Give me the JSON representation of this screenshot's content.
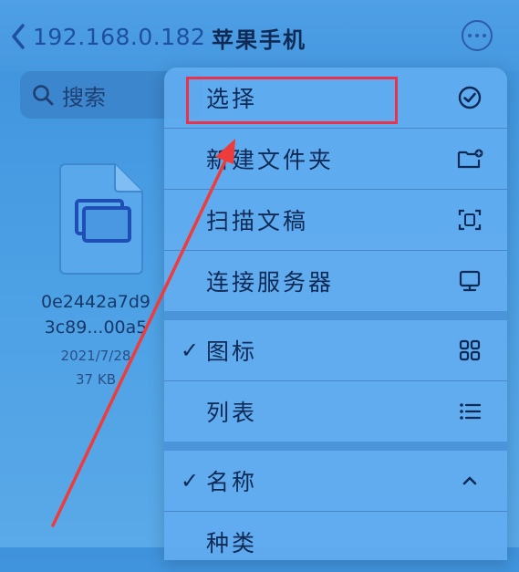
{
  "navbar": {
    "back_label": "192.168.0.182",
    "title": "苹果手机",
    "more_icon": "ellipsis-circle-icon"
  },
  "search": {
    "placeholder": "搜索"
  },
  "file": {
    "name_line1": "0e2442a7d9",
    "name_line2": "3c89...00a5",
    "date": "2021/7/28",
    "size": "37 KB"
  },
  "menu": {
    "items": [
      {
        "label": "选择",
        "icon": "checkmark-circle-icon",
        "checked": false
      },
      {
        "label": "新建文件夹",
        "icon": "folder-badge-plus-icon",
        "checked": false
      },
      {
        "label": "扫描文稿",
        "icon": "doc-viewfinder-icon",
        "checked": false
      },
      {
        "label": "连接服务器",
        "icon": "display-icon",
        "checked": false
      },
      {
        "label": "图标",
        "icon": "grid-icon",
        "checked": true
      },
      {
        "label": "列表",
        "icon": "list-icon",
        "checked": false
      },
      {
        "label": "名称",
        "icon": "chevron-up-icon",
        "checked": true
      },
      {
        "label": "种类",
        "icon": "",
        "checked": false
      }
    ]
  },
  "annotation": {
    "highlight_color": "#e8334a",
    "arrow_color": "#ee3b3b"
  }
}
